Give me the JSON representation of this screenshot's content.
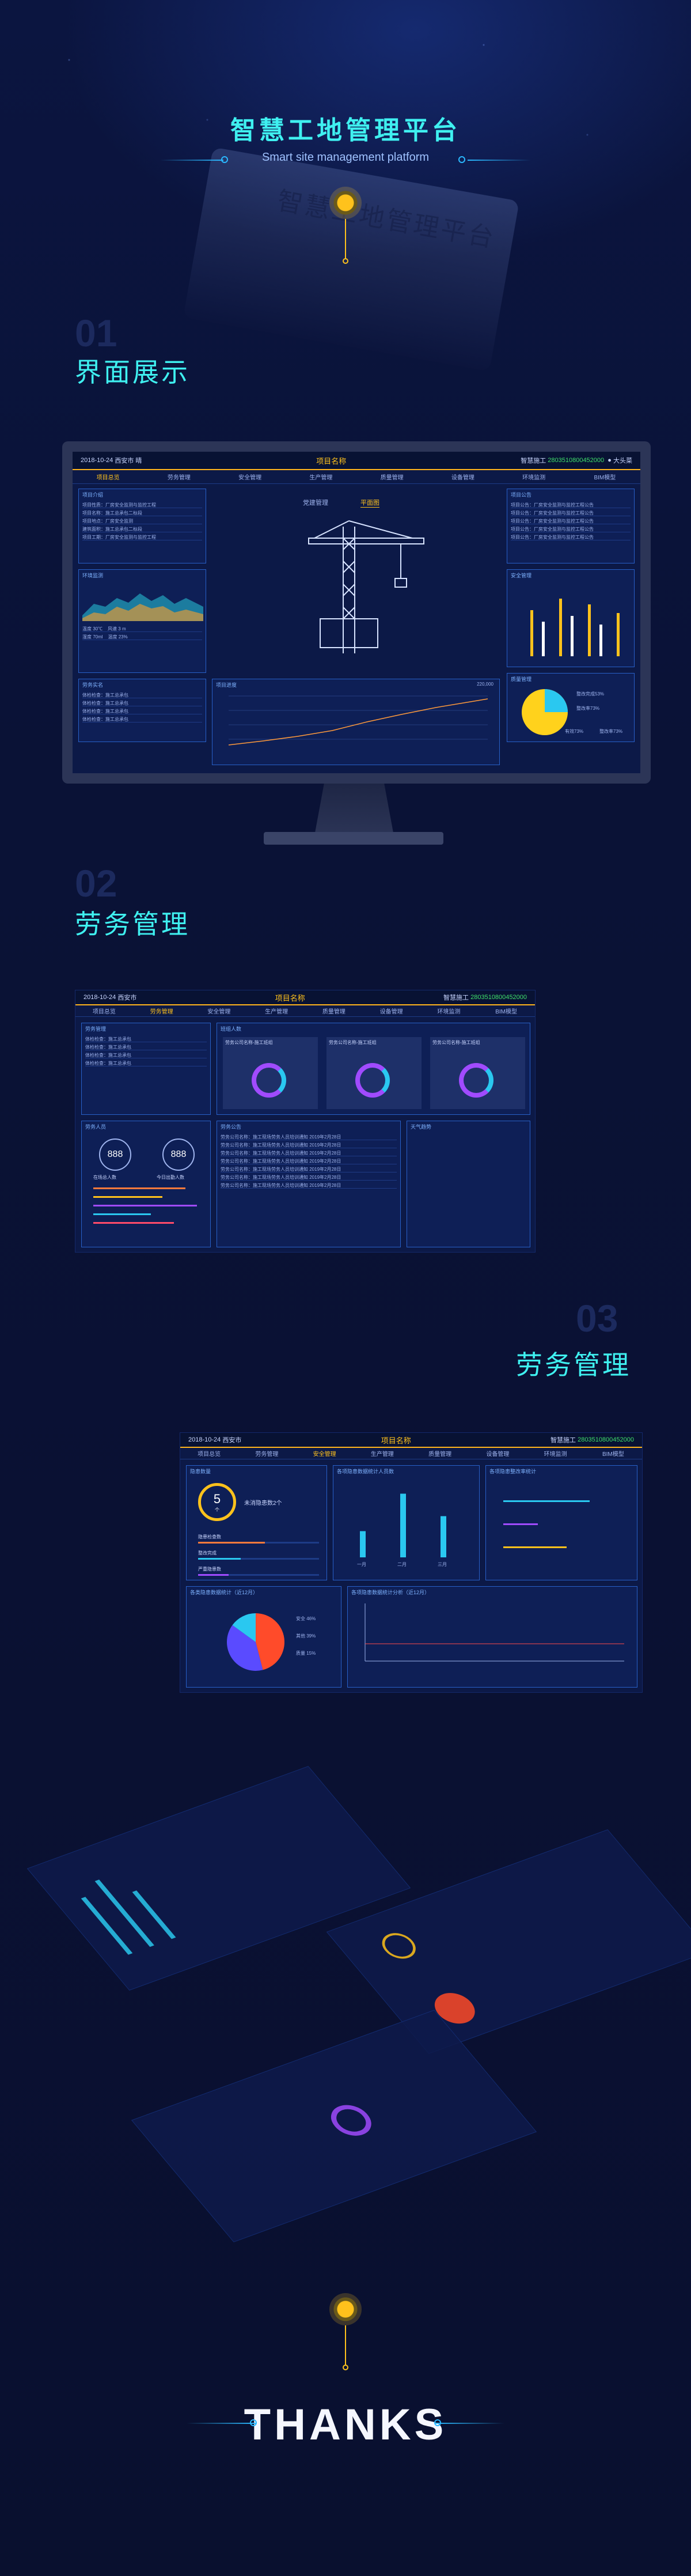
{
  "hero": {
    "title": "智慧工地管理平台",
    "subtitle": "Smart site management platform",
    "ghost_title": "智慧工地管理平台"
  },
  "sections": [
    {
      "num": "01",
      "title": "界面展示"
    },
    {
      "num": "02",
      "title": "劳务管理"
    },
    {
      "num": "03",
      "title": "劳务管理"
    }
  ],
  "dashboard": {
    "date": "2018-10-24",
    "city": "西安市",
    "weather": "晴",
    "project_title": "项目名称",
    "phone_label": "智慧施工",
    "phone": "2803510800452000",
    "user": "大头菜",
    "nav": [
      "项目总览",
      "劳务管理",
      "安全管理",
      "生产管理",
      "质量管理",
      "设备管理",
      "环境监测",
      "BIM模型"
    ],
    "active_nav": 0,
    "left_panels": [
      "项目介绍",
      "环境监测",
      "劳务实名"
    ],
    "right_panels": [
      "项目公告",
      "安全管理",
      "质量管理"
    ],
    "tabs": [
      "党建管理",
      "平面图"
    ],
    "progress_title": "项目进度",
    "pie_label_a": "整改完成53%",
    "pie_label_b": "整改率73%",
    "pie_label_c": "有效73%",
    "pie_label_d": "整改率73%",
    "env": [
      {
        "k": "温度",
        "v": "30℃"
      },
      {
        "k": "风速",
        "v": "3 m"
      },
      {
        "k": "湿度",
        "v": "70ml"
      },
      {
        "k": "温度",
        "v": "23%"
      }
    ],
    "list_rows": [
      "项目性质：厂房安全监测与监控工程",
      "项目名称：施工总承包二标段",
      "项目地点：厂房安全监测",
      "建筑面积：施工总承包二标段",
      "项目工期：厂房安全监测与监控工程"
    ],
    "notice_rows": [
      "项目公告：厂房安全监测与监控工程公告",
      "项目公告：厂房安全监测与监控工程公告",
      "项目公告：厂房安全监测与监控工程公告",
      "项目公告：厂房安全监测与监控工程公告",
      "项目公告：厂房安全监测与监控工程公告"
    ],
    "labor_rows": [
      "体检检查：施工总承包",
      "体检检查：施工总承包",
      "体检检查：施工总承包",
      "体检检查：施工总承包"
    ],
    "legend_total": "220,000"
  },
  "labor": {
    "panels": [
      "劳务管理",
      "劳务人员",
      "班组人数",
      "劳务公告",
      "天气趋势"
    ],
    "counts": [
      "888",
      "888"
    ],
    "count_labels": [
      "在场总人数",
      "今日出勤人数"
    ],
    "donut_titles": [
      "劳务公司名称-施工班组",
      "劳务公司名称-施工班组",
      "劳务公司名称-施工班组"
    ],
    "notice": "劳务公司名称：施工现场劳务人员培训通知",
    "dates": "2019年2月28日"
  },
  "safety": {
    "panels": [
      "隐患数量",
      "各项隐患数据统计人员数",
      "各项隐患整改率统计",
      "各类隐患数据统计（近12月）",
      "各项隐患数据统计分析（近12月）"
    ],
    "count": "5",
    "count_unit": "个",
    "count_label": "未消隐患数2个",
    "bars": [
      {
        "label": "一月",
        "value": 35
      },
      {
        "label": "二月",
        "value": 85
      },
      {
        "label": "三月",
        "value": 55
      }
    ],
    "pie": [
      {
        "label": "安全",
        "value": 46
      },
      {
        "label": "其他",
        "value": 39
      },
      {
        "label": "质量",
        "value": 15
      }
    ],
    "progress_rows": [
      {
        "label": "隐患检查数",
        "value": 0.55
      },
      {
        "label": "整改完成",
        "value": 0.35
      },
      {
        "label": "严重隐患数",
        "value": 0.25
      }
    ]
  },
  "thanks": "THANKS"
}
